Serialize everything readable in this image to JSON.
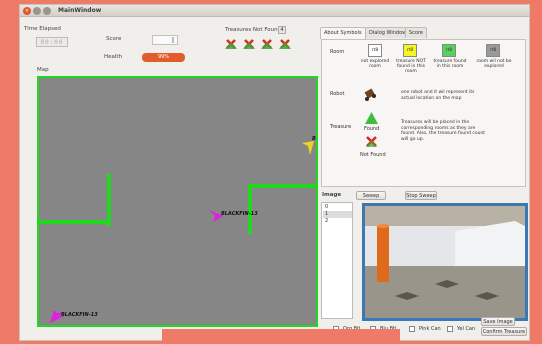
{
  "window": {
    "title": "MainWindow",
    "close_glyph": "×"
  },
  "status": {
    "time_elapsed_label": "Time Elapsed",
    "time_value": "00:00",
    "score_label": "Score",
    "health_label": "Health",
    "health_value": "99%",
    "health_fraction": 0.99,
    "treasures_not_found_label": "Treasures Not Found",
    "treasures_not_found_count": "4"
  },
  "map": {
    "label": "Map",
    "robots": [
      {
        "name": "BLACKFIN-13",
        "color": "#e020e0"
      },
      {
        "name": "BLACKFIN-13",
        "color": "#e020e0"
      },
      {
        "name": "BL",
        "color": "#f0d020"
      }
    ]
  },
  "tabs": [
    "About Symbols",
    "Dialog Window",
    "Score"
  ],
  "legend": {
    "room_label": "Room",
    "room_box_text": "rt8",
    "rooms": [
      {
        "color": "#ffffff",
        "desc": [
          "not explored",
          "room"
        ]
      },
      {
        "color": "#f5f520",
        "desc": [
          "treasure NOT",
          "found in this",
          "room"
        ]
      },
      {
        "color": "#56d25a",
        "desc": [
          "treasure found",
          "in this room"
        ]
      },
      {
        "color": "#999999",
        "desc": [
          "room wil not be",
          "explored"
        ]
      }
    ],
    "robot_label": "Robot",
    "robot_desc": [
      "one robot and it wil represent its",
      "actual location on the map"
    ],
    "treasure_label": "Treasure",
    "found_label": "Found",
    "not_found_label": "Not Found",
    "treasure_desc": [
      "Treasures will be placed in the",
      "corresponding rooms as they are",
      "found. Also, the treasure found count",
      "will go up."
    ]
  },
  "image_panel": {
    "label": "Image",
    "items": [
      "0",
      "1",
      "2"
    ],
    "selected_index": 1,
    "sweep_label": "Sweep",
    "stop_sweep_label": "Stop Sweep",
    "save_image_label": "Save Image",
    "confirm_treasure_label": "Confirm Treasure"
  },
  "checkboxes": [
    "Org Btl",
    "Blu Btl",
    "Pink Can",
    "Yel Can"
  ],
  "colors": {
    "wall": "#1fd81f",
    "map_bg": "#868686",
    "accent": "#e35d2a",
    "camera_border": "#3e78b4"
  }
}
